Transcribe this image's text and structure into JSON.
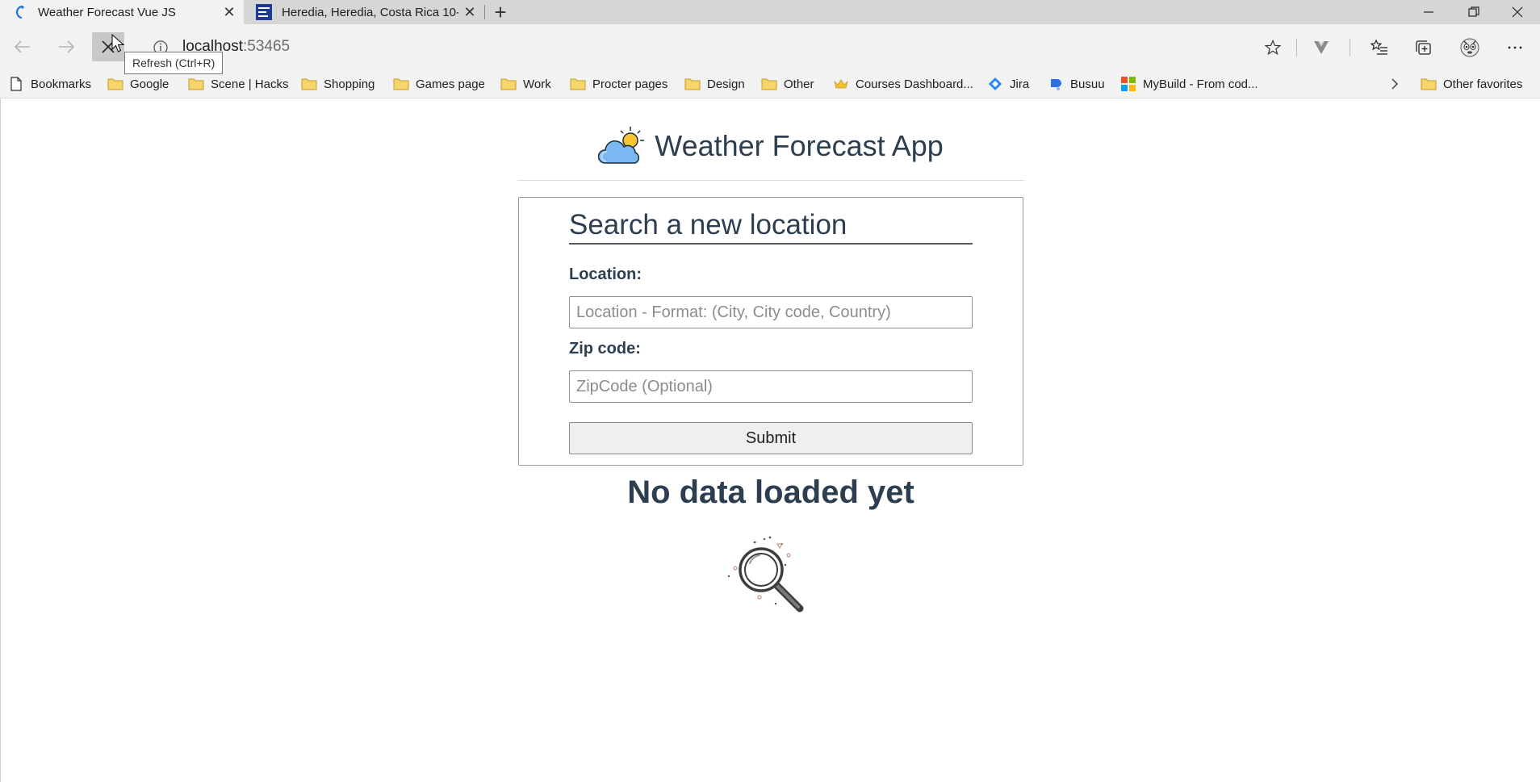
{
  "browser": {
    "tabs": [
      {
        "title": "Weather Forecast Vue JS",
        "active": true
      },
      {
        "title": "Heredia, Heredia, Costa Rica 10-",
        "active": false
      }
    ],
    "address": {
      "host": "localhost",
      "port": ":53465"
    },
    "tooltip": "Refresh (Ctrl+R)",
    "bookmarks": [
      {
        "label": "Bookmarks",
        "icon": "page-icon"
      },
      {
        "label": "Google",
        "icon": "folder-icon"
      },
      {
        "label": "Scene | Hacks",
        "icon": "folder-icon"
      },
      {
        "label": "Shopping",
        "icon": "folder-icon"
      },
      {
        "label": "Games page",
        "icon": "folder-icon"
      },
      {
        "label": "Work",
        "icon": "folder-icon"
      },
      {
        "label": "Procter pages",
        "icon": "folder-icon"
      },
      {
        "label": "Design",
        "icon": "folder-icon"
      },
      {
        "label": "Other",
        "icon": "folder-icon"
      },
      {
        "label": "Courses Dashboard...",
        "icon": "crown-icon"
      },
      {
        "label": "Jira",
        "icon": "jira-icon"
      },
      {
        "label": "Busuu",
        "icon": "busuu-icon"
      },
      {
        "label": "MyBuild - From cod...",
        "icon": "microsoft-icon"
      }
    ],
    "other_favorites": "Other favorites"
  },
  "app": {
    "title": "Weather Forecast App",
    "form": {
      "heading": "Search a new location",
      "location_label": "Location:",
      "location_placeholder": "Location - Format: (City, City code, Country)",
      "zip_label": "Zip code:",
      "zip_placeholder": "ZipCode (Optional)",
      "submit_label": "Submit"
    },
    "empty_state": "No data loaded yet"
  },
  "colors": {
    "heading": "#2c3e50",
    "tab_active": "#f2f2f2",
    "tabstrip": "#d6d6d6"
  }
}
